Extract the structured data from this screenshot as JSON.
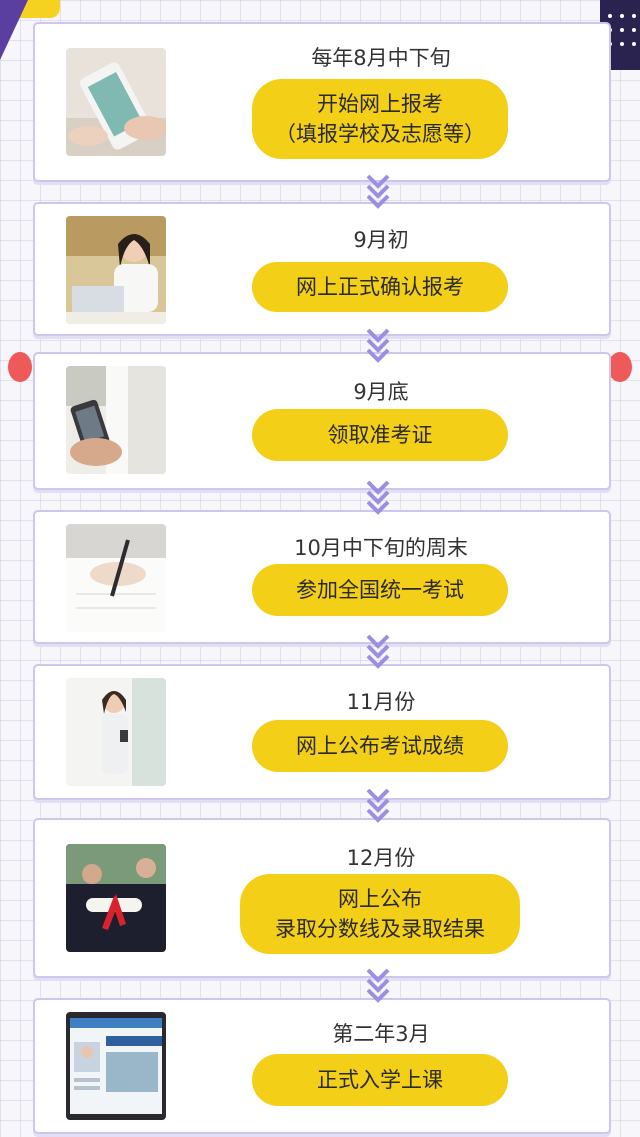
{
  "steps": [
    {
      "date": "每年8月中下旬",
      "lines": [
        "开始网上报考",
        "（填报学校及志愿等）"
      ]
    },
    {
      "date": "9月初",
      "lines": [
        "网上正式确认报考"
      ]
    },
    {
      "date": "9月底",
      "lines": [
        "领取准考证"
      ]
    },
    {
      "date": "10月中下旬的周末",
      "lines": [
        "参加全国统一考试"
      ]
    },
    {
      "date": "11月份",
      "lines": [
        "网上公布考试成绩"
      ]
    },
    {
      "date": "12月份",
      "lines": [
        "网上公布",
        "录取分数线及录取结果"
      ]
    },
    {
      "date": "第二年3月",
      "lines": [
        "正式入学上课"
      ]
    }
  ],
  "colors": {
    "accent": "#f3cf18",
    "arrow": "#9b8fe0",
    "card_border": "#cfc6ec",
    "corner_red": "#ee5a5a"
  },
  "icons": [
    "chevron-down-icon"
  ]
}
